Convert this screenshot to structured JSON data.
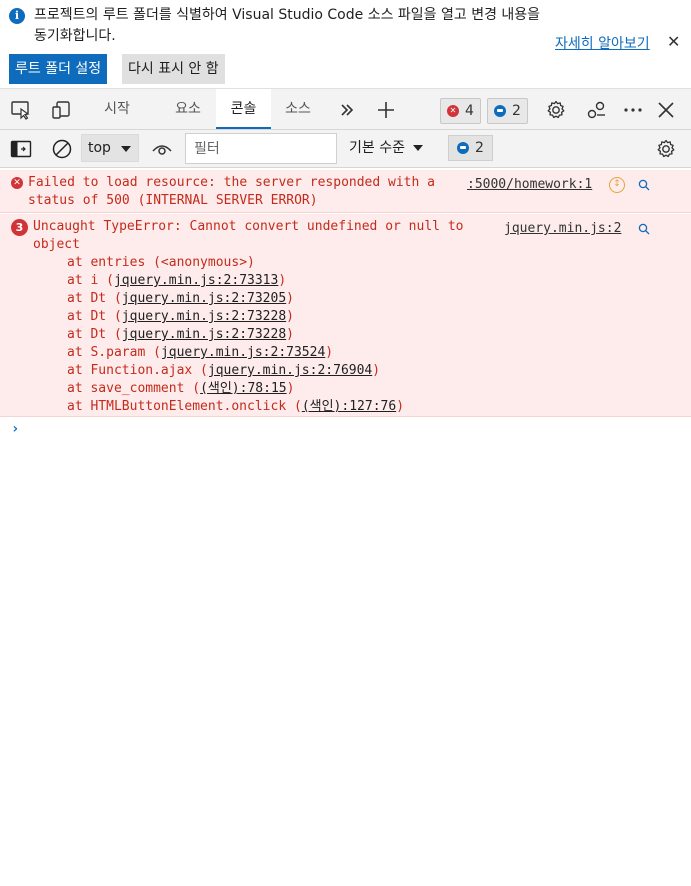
{
  "banner": {
    "message": "프로젝트의 루트 폴더를 식별하여 Visual Studio Code 소스 파일을 열고 변경 내용을 동기화합니다.",
    "learn_more": "자세히 알아보기",
    "primary_button": "루트 폴더 설정",
    "secondary_button": "다시 표시 안 함"
  },
  "tabs": [
    {
      "label": "시작"
    },
    {
      "label": "요소"
    },
    {
      "label": "콘솔",
      "active": true
    },
    {
      "label": "소스"
    }
  ],
  "badges": {
    "errors": "4",
    "messages": "2"
  },
  "console_toolbar": {
    "context": "top",
    "filter_placeholder": "필터",
    "levels": "기본 수준",
    "message_count": "2"
  },
  "entries": [
    {
      "text_line1": "Failed to load resource: the server responded with a",
      "text_line2": "status of 500 (INTERNAL SERVER ERROR)",
      "source": ":5000/homework:1"
    },
    {
      "count": "3",
      "text_line1": "Uncaught TypeError: Cannot convert undefined or null to",
      "text_line2": "object",
      "source": "jquery.min.js:2",
      "stack": [
        {
          "prefix": "at entries (",
          "link": "",
          "suffix": "<anonymous>)"
        },
        {
          "prefix": "at i (",
          "link": "jquery.min.js:2:73313",
          "suffix": ")"
        },
        {
          "prefix": "at Dt (",
          "link": "jquery.min.js:2:73205",
          "suffix": ")"
        },
        {
          "prefix": "at Dt (",
          "link": "jquery.min.js:2:73228",
          "suffix": ")"
        },
        {
          "prefix": "at Dt (",
          "link": "jquery.min.js:2:73228",
          "suffix": ")"
        },
        {
          "prefix": "at S.param (",
          "link": "jquery.min.js:2:73524",
          "suffix": ")"
        },
        {
          "prefix": "at Function.ajax (",
          "link": "jquery.min.js:2:76904",
          "suffix": ")"
        },
        {
          "prefix": "at save_comment (",
          "link": "(색인):78:15",
          "suffix": ")"
        },
        {
          "prefix": "at HTMLButtonElement.onclick (",
          "link": "(색인):127:76",
          "suffix": ")"
        }
      ]
    }
  ],
  "colors": {
    "accent": "#0f6cbd",
    "error_text": "#c42b1c",
    "error_bg": "#fdeceb"
  }
}
